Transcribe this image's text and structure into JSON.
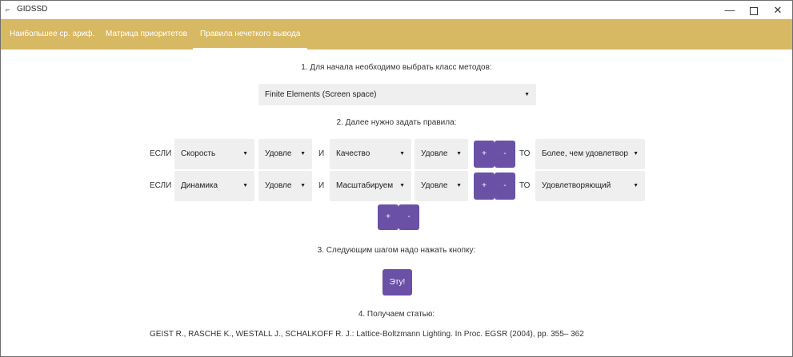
{
  "window": {
    "title": "GIDSSD",
    "icon": "app-logo-icon",
    "controls": {
      "minimize": "—",
      "close": "✕"
    }
  },
  "tabs": [
    {
      "label": "Наибольшее ср. ариф."
    },
    {
      "label": "Матрица приоритетов"
    },
    {
      "label": "Правила нечеткого вывода",
      "active": true
    }
  ],
  "step1": {
    "text": "1. Для начала необходимо выбрать класс методов:",
    "method_value": "Finite Elements (Screen space)"
  },
  "step2": {
    "text": "2. Далее нужно задать правила:",
    "if_label": "ЕСЛИ",
    "and_label": "И",
    "then_label": "ТО",
    "rules": [
      {
        "param1": "Скорость",
        "value1": "Удовле",
        "param2": "Качество",
        "value2": "Удовле",
        "result": "Более, чем удовлетвор"
      },
      {
        "param1": "Динамика",
        "value1": "Удовле",
        "param2": "Масштабируем",
        "value2": "Удовле",
        "result": "Удовлетворяющий"
      }
    ],
    "plus": "+",
    "minus": "-"
  },
  "step3": {
    "text": "3. Следующим шагом надо нажать кнопку:",
    "button": "Эту!"
  },
  "step4": {
    "text": "4. Получаем статью:",
    "citation": "GEIST R., RASCHE K., WESTALL J., SCHALKOFF R. J.: Lattice-Boltzmann Lighting. In Proc. EGSR (2004), pp. 355– 362"
  },
  "colors": {
    "accent_bar": "#d7b863",
    "button": "#6a51a6",
    "select_bg": "#efefef"
  }
}
